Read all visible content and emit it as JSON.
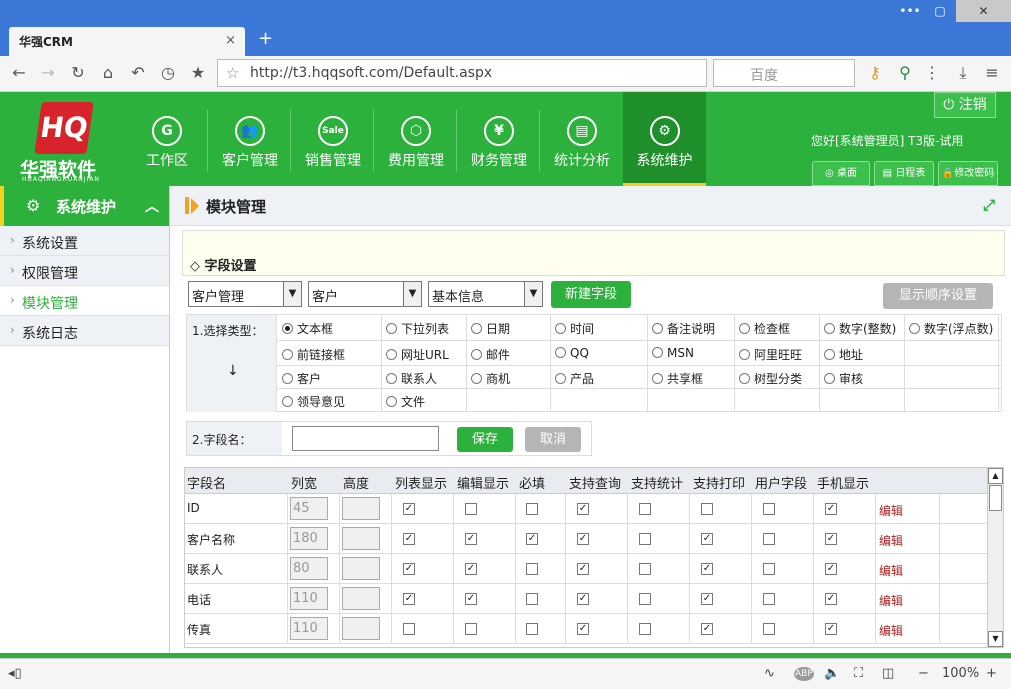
{
  "browser": {
    "tab_title": "华强CRM",
    "tab_close": "×",
    "new_tab": "+",
    "url": "http://t3.hqqsoft.com/Default.aspx",
    "search_placeholder": "百度",
    "window_controls": [
      "•••",
      "▢",
      "✕"
    ]
  },
  "app": {
    "logo_mark": "HQ",
    "logo_text": "华强软件",
    "logo_sub": "HUAQIANGRUANJIAN",
    "nav": [
      {
        "label": "工作区",
        "icon": "G"
      },
      {
        "label": "客户管理",
        "icon": "👥"
      },
      {
        "label": "销售管理",
        "icon": "Sale"
      },
      {
        "label": "费用管理",
        "icon": "⬡"
      },
      {
        "label": "财务管理",
        "icon": "¥"
      },
      {
        "label": "统计分析",
        "icon": "▤"
      },
      {
        "label": "系统维护",
        "icon": "⚙"
      }
    ],
    "logout": "注销",
    "greeting": "您好[系统管理员] T3版-试用",
    "mini_buttons": [
      "桌面",
      "日程表",
      "修改密码"
    ]
  },
  "sidebar": {
    "title": "系统维护",
    "items": [
      {
        "label": "系统设置"
      },
      {
        "label": "权限管理"
      },
      {
        "label": "模块管理"
      },
      {
        "label": "系统日志"
      }
    ]
  },
  "page": {
    "title": "模块管理",
    "section": "字段设置",
    "selects": [
      "客户管理",
      "客户",
      "基本信息"
    ],
    "new_field": "新建字段",
    "display_order": "显示顺序设置",
    "select_type_label": "1.选择类型：",
    "down_arrow": "↓",
    "types": [
      "文本框",
      "下拉列表",
      "日期",
      "时间",
      "备注说明",
      "检查框",
      "数字(整数)",
      "数字(浮点数)",
      "前链接框",
      "网址URL",
      "邮件",
      "QQ",
      "MSN",
      "阿里旺旺",
      "地址",
      "客户",
      "联系人",
      "商机",
      "产品",
      "共享框",
      "树型分类",
      "审核",
      "领导意见",
      "文件"
    ],
    "field_name_label": "2.字段名：",
    "field_name_value": "",
    "save": "保存",
    "cancel": "取消"
  },
  "grid": {
    "headers": [
      "字段名",
      "列宽",
      "高度",
      "列表显示",
      "编辑显示",
      "必填",
      "支持查询",
      "支持统计",
      "支持打印",
      "用户字段",
      "手机显示"
    ],
    "edit_label": "编辑",
    "rows": [
      {
        "name": "ID",
        "width": "45",
        "height": "",
        "checks": [
          true,
          false,
          false,
          true,
          false,
          false,
          false,
          true
        ]
      },
      {
        "name": "客户名称",
        "width": "180",
        "height": "",
        "checks": [
          true,
          true,
          true,
          true,
          false,
          true,
          false,
          true
        ]
      },
      {
        "name": "联系人",
        "width": "80",
        "height": "",
        "checks": [
          true,
          true,
          false,
          true,
          false,
          true,
          false,
          true
        ]
      },
      {
        "name": "电话",
        "width": "110",
        "height": "",
        "checks": [
          true,
          true,
          false,
          true,
          false,
          true,
          false,
          true
        ]
      },
      {
        "name": "传真",
        "width": "110",
        "height": "",
        "checks": [
          false,
          false,
          false,
          true,
          false,
          true,
          false,
          true
        ]
      }
    ]
  },
  "status": {
    "zoom": "100%",
    "zoom_minus": "−",
    "zoom_plus": "+"
  },
  "colors": {
    "brand_green": "#2db13d",
    "active_nav": "#1f8f2b",
    "accent_yellow": "#f3d21f",
    "browser_blue": "#3b78d8",
    "edit_red": "#b02020"
  }
}
